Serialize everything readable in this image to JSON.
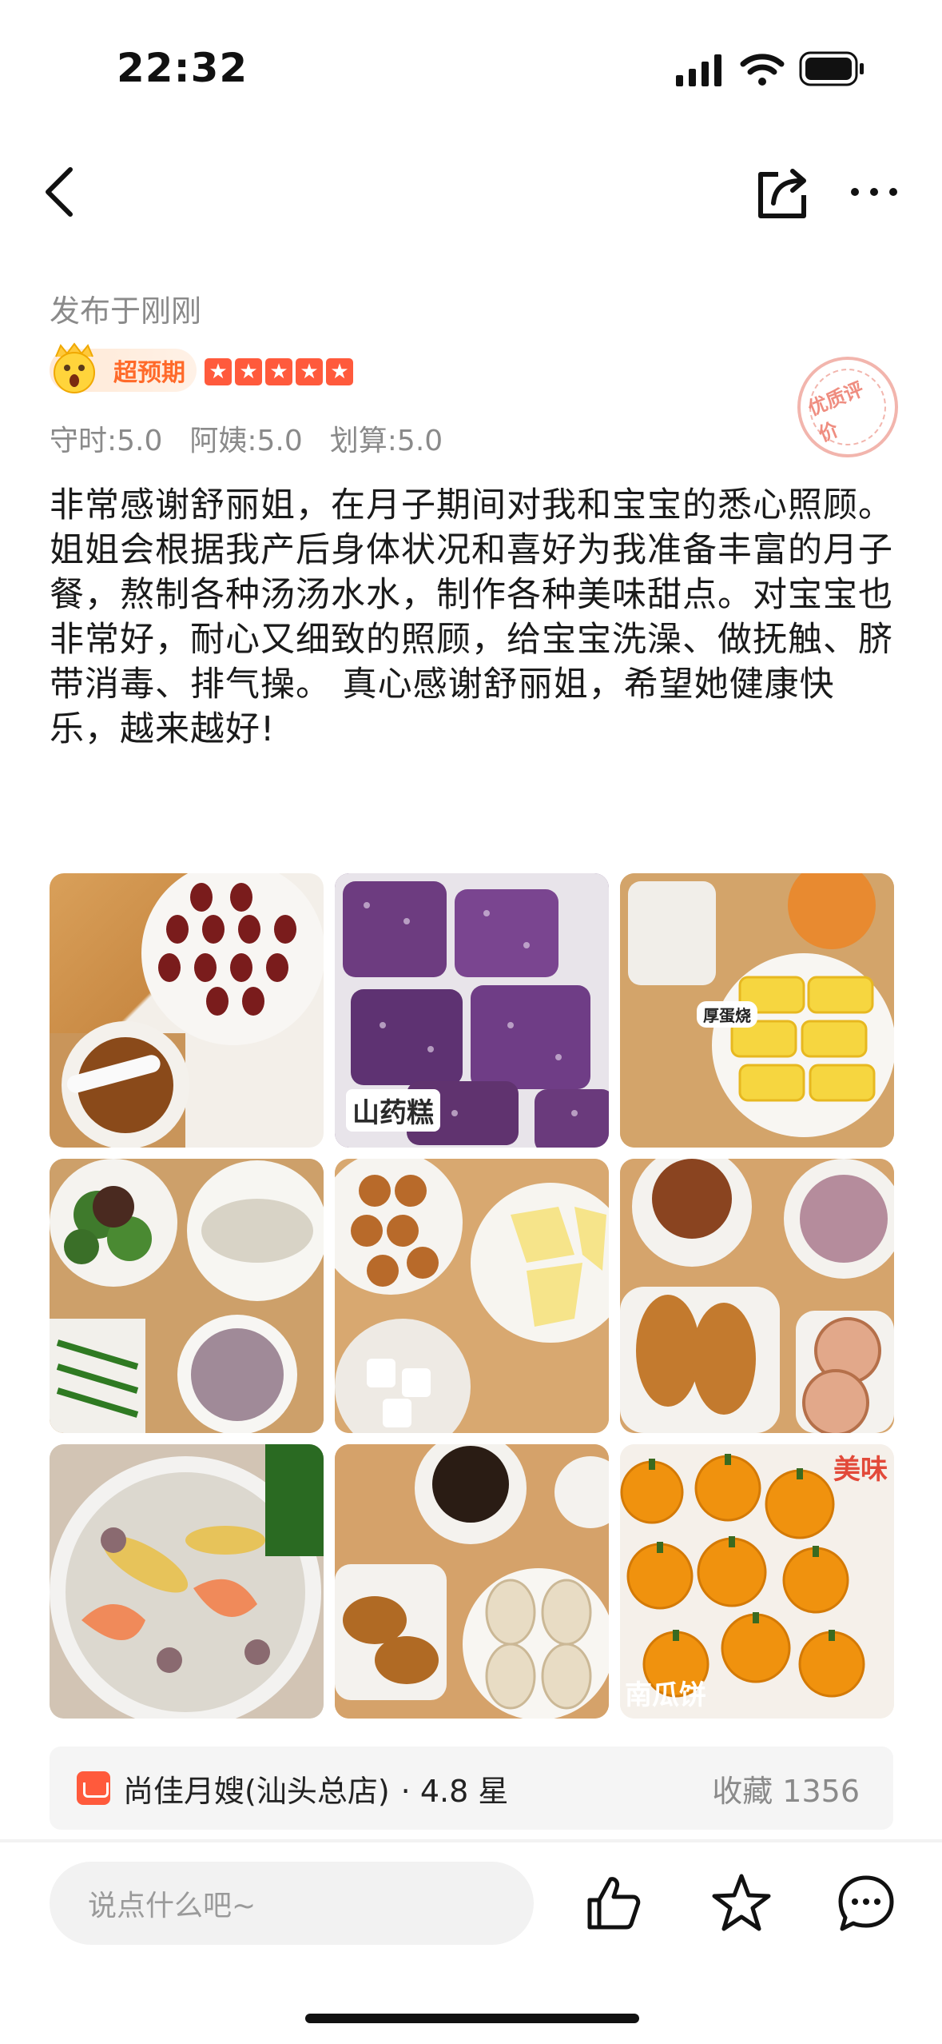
{
  "status_bar": {
    "time": "22:32"
  },
  "review": {
    "posted": "发布于刚刚",
    "badge": "超预期",
    "stars": 5,
    "scores": [
      "守时:5.0",
      "阿姨:5.0",
      "划算:5.0"
    ],
    "stamp": "优质评价",
    "text": "非常感谢舒丽姐，在月子期间对我和宝宝的悉心照顾。姐姐会根据我产后身体状况和喜好为我准备丰富的月子餐，熬制各种汤汤水水，制作各种美味甜点。对宝宝也非常好，耐心又细致的照顾，给宝宝洗澡、做抚触、脐带消毒、排气操。 真心感谢舒丽姐，希望她健康快乐，越来越好!"
  },
  "photos": {
    "labels": {
      "p2": "山药糕",
      "p3": "厚蛋烧",
      "p9": "南瓜饼",
      "p9b": "美味"
    }
  },
  "shop": {
    "name": "尚佳月嫂(汕头总店)",
    "rating": "· 4.8 星",
    "favorites": "收藏 1356"
  },
  "bottom_bar": {
    "comment_placeholder": "说点什么吧~"
  }
}
